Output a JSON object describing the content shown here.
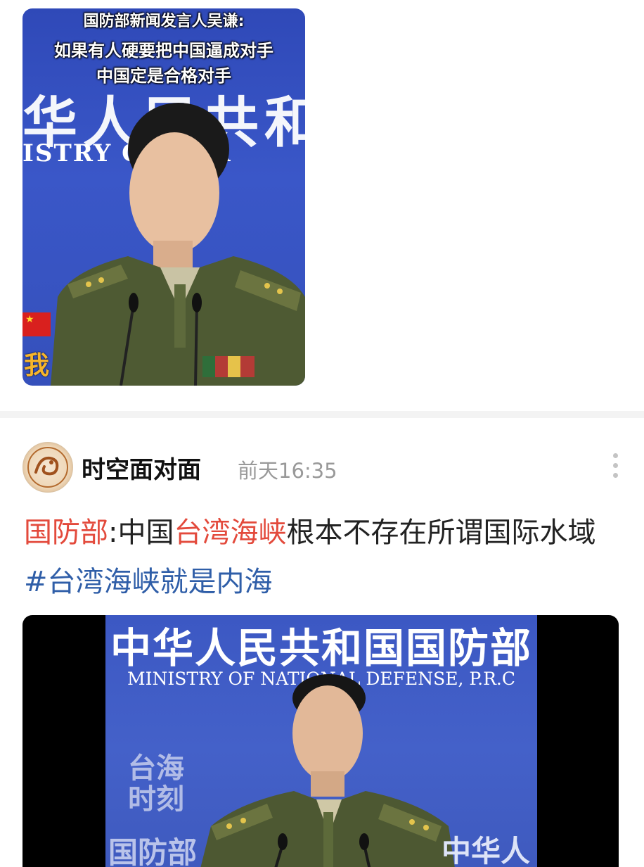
{
  "post1": {
    "image": {
      "caption_line1": "国防部新闻发言人吴谦:",
      "caption_line2": "如果有人硬要把中国逼成对手",
      "caption_line3": "中国定是合格对手",
      "bg_text_cn": "华人民共和",
      "bg_text_en": "ISTRY O   IONA",
      "side_text": "我"
    }
  },
  "post2": {
    "author": "时空面对面",
    "time": "前天16:35",
    "text": {
      "seg1": "国防部",
      "seg2": ":中国",
      "seg3": "台湾海峡",
      "seg4": "根本不存在所谓国际水域",
      "hashtag": "#台湾海峡就是内海"
    },
    "video": {
      "title_cn": "中华人民共和国国防部",
      "title_en": "MINISTRY OF NATIONAL DEFENSE, P.R.C",
      "logo_text": "台海时刻",
      "left_text": "国防部",
      "right_text": "中华人"
    }
  },
  "colors": {
    "topic_red": "#e34a3c",
    "hashtag_blue": "#2f5ea8",
    "backdrop_blue": "#3a57c8"
  }
}
